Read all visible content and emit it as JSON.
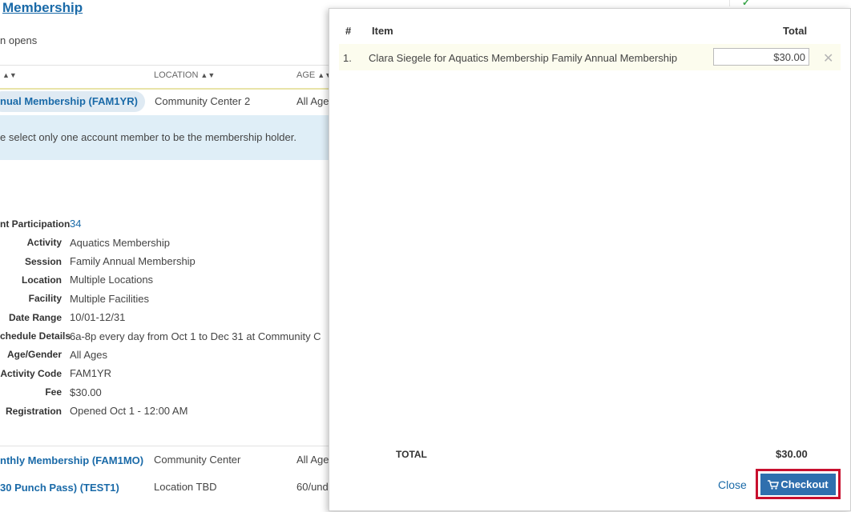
{
  "background": {
    "title": "Membership",
    "subtitle": "n opens",
    "table_headers": [
      {
        "label": "",
        "sort": "▲▼"
      },
      {
        "label": "LOCATION",
        "sort": "▲▼"
      },
      {
        "label": "AGE",
        "sort": "▲▼"
      }
    ],
    "selected_row": {
      "name": "nual Membership (FAM1YR)",
      "location": "Community Center 2",
      "age": "All Age"
    },
    "info_message": "e select only one account member to be the membership holder.",
    "details": [
      {
        "label": "nt Participation",
        "value": "34",
        "link": true
      },
      {
        "label": "Activity",
        "value": "Aquatics Membership"
      },
      {
        "label": "Session",
        "value": "Family Annual Membership"
      },
      {
        "label": "Location",
        "value": "Multiple Locations"
      },
      {
        "label": "Facility",
        "value": "Multiple Facilities"
      },
      {
        "label": "Date Range",
        "value": "10/01-12/31"
      },
      {
        "label": "chedule Details",
        "value": "6a-8p every day from Oct 1 to Dec 31 at Community C"
      },
      {
        "label": "Age/Gender",
        "value": "All Ages"
      },
      {
        "label": "Activity Code",
        "value": "FAM1YR"
      },
      {
        "label": "Fee",
        "value": "$30.00"
      },
      {
        "label": "Registration",
        "value": "Opened Oct 1 - 12:00 AM"
      }
    ],
    "rows": [
      {
        "name": "nthly Membership (FAM1MO)",
        "location": "Community Center",
        "age": "All Age"
      },
      {
        "name": "30 Punch Pass) (TEST1)",
        "location": "Location TBD",
        "age": "60/und"
      }
    ]
  },
  "cart": {
    "headers": {
      "num": "#",
      "item": "Item",
      "total": "Total"
    },
    "items": [
      {
        "num": "1.",
        "description": "Clara Siegele for Aquatics Membership Family Annual Membership",
        "amount": "$30.00",
        "remove_icon": "close-icon"
      }
    ],
    "total_label": "TOTAL",
    "total_value": "$30.00",
    "close_label": "Close",
    "checkout_label": "Checkout",
    "checkout_icon": "cart-icon",
    "colors": {
      "accent": "#2f6fae",
      "highlight": "#c8102e",
      "link": "#1a6aa8"
    }
  }
}
